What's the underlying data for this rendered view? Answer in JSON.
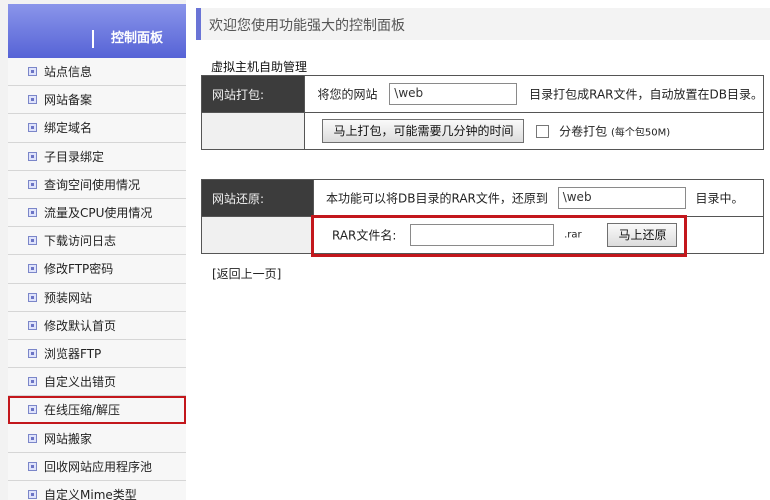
{
  "sidebar": {
    "title": "控制面板",
    "items": [
      {
        "label": "站点信息"
      },
      {
        "label": "网站备案"
      },
      {
        "label": "绑定域名"
      },
      {
        "label": "子目录绑定"
      },
      {
        "label": "查询空间使用情况"
      },
      {
        "label": "流量及CPU使用情况"
      },
      {
        "label": "下载访问日志"
      },
      {
        "label": "修改FTP密码"
      },
      {
        "label": "预装网站"
      },
      {
        "label": "修改默认首页"
      },
      {
        "label": "浏览器FTP"
      },
      {
        "label": "自定义出错页"
      },
      {
        "label": "在线压缩/解压"
      },
      {
        "label": "网站搬家"
      },
      {
        "label": "回收网站应用程序池"
      },
      {
        "label": "自定义Mime类型"
      }
    ]
  },
  "header": {
    "title": "欢迎您使用功能强大的控制面板"
  },
  "section": {
    "caption": "虚拟主机自助管理"
  },
  "pack": {
    "label": "网站打包:",
    "prefix": "将您的网站",
    "path_value": "\\web",
    "suffix": "目录打包成RAR文件，自动放置在DB目录。",
    "button": "马上打包，可能需要几分钟的时间",
    "split_label": "分卷打包",
    "split_note": "(每个包50M)"
  },
  "restore": {
    "label": "网站还原:",
    "prefix": "本功能可以将DB目录的RAR文件，还原到",
    "path_value": "\\web",
    "suffix": "目录中。",
    "file_label": "RAR文件名:",
    "file_value": "",
    "ext": ".rar",
    "button": "马上还原"
  },
  "back_link": "[返回上一页]"
}
